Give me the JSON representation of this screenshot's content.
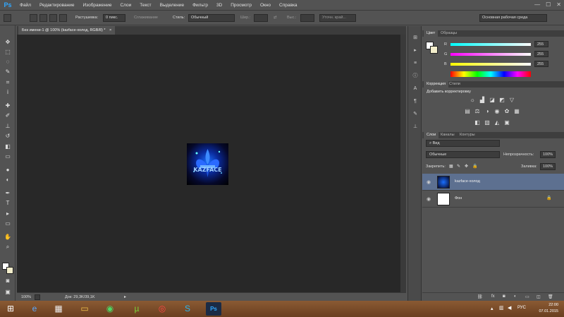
{
  "app": {
    "logo": "Ps"
  },
  "menu": [
    "Файл",
    "Редактирование",
    "Изображение",
    "Слои",
    "Текст",
    "Выделение",
    "Фильтр",
    "3D",
    "Просмотр",
    "Окно",
    "Справка"
  ],
  "window_controls": {
    "minimize": "—",
    "maximize": "☐",
    "close": "✕"
  },
  "options": {
    "feather_label": "Растушевка:",
    "feather_value": "0 пикс.",
    "antialias_label": "Сглаживание",
    "style_label": "Стиль:",
    "style_value": "Обычный",
    "width_label": "Шир.:",
    "height_label": "Выс.:",
    "refine_edge": "Уточн. край...",
    "workspace": "Основная рабочая среда"
  },
  "document": {
    "tab_title": "Без имени-1 @ 100% (kazface-холод, RGB/8) *",
    "close_glyph": "×",
    "zoom": "100%",
    "doc_size": "Док: 29,3K/39,1K"
  },
  "color_panel": {
    "tabs": [
      "Цвет",
      "Образцы"
    ],
    "channels": [
      {
        "label": "R",
        "value": "255"
      },
      {
        "label": "G",
        "value": "255"
      },
      {
        "label": "B",
        "value": "255"
      }
    ]
  },
  "adjustments_panel": {
    "tabs": [
      "Коррекция",
      "Стили"
    ],
    "heading": "Добавить корректировку"
  },
  "layers_panel": {
    "tabs": [
      "Слои",
      "Каналы",
      "Контуры"
    ],
    "filter": "Вид",
    "blend_mode": "Обычные",
    "opacity_label": "Непрозрачность:",
    "opacity_value": "100%",
    "lock_label": "Закрепить:",
    "fill_label": "Заливка:",
    "fill_value": "100%",
    "layers": [
      {
        "name": "kazface-холод",
        "selected": true
      },
      {
        "name": "Фон",
        "selected": false
      }
    ]
  },
  "taskbar": {
    "lang": "РУС",
    "time": "22:00",
    "date": "07.01.2015"
  }
}
